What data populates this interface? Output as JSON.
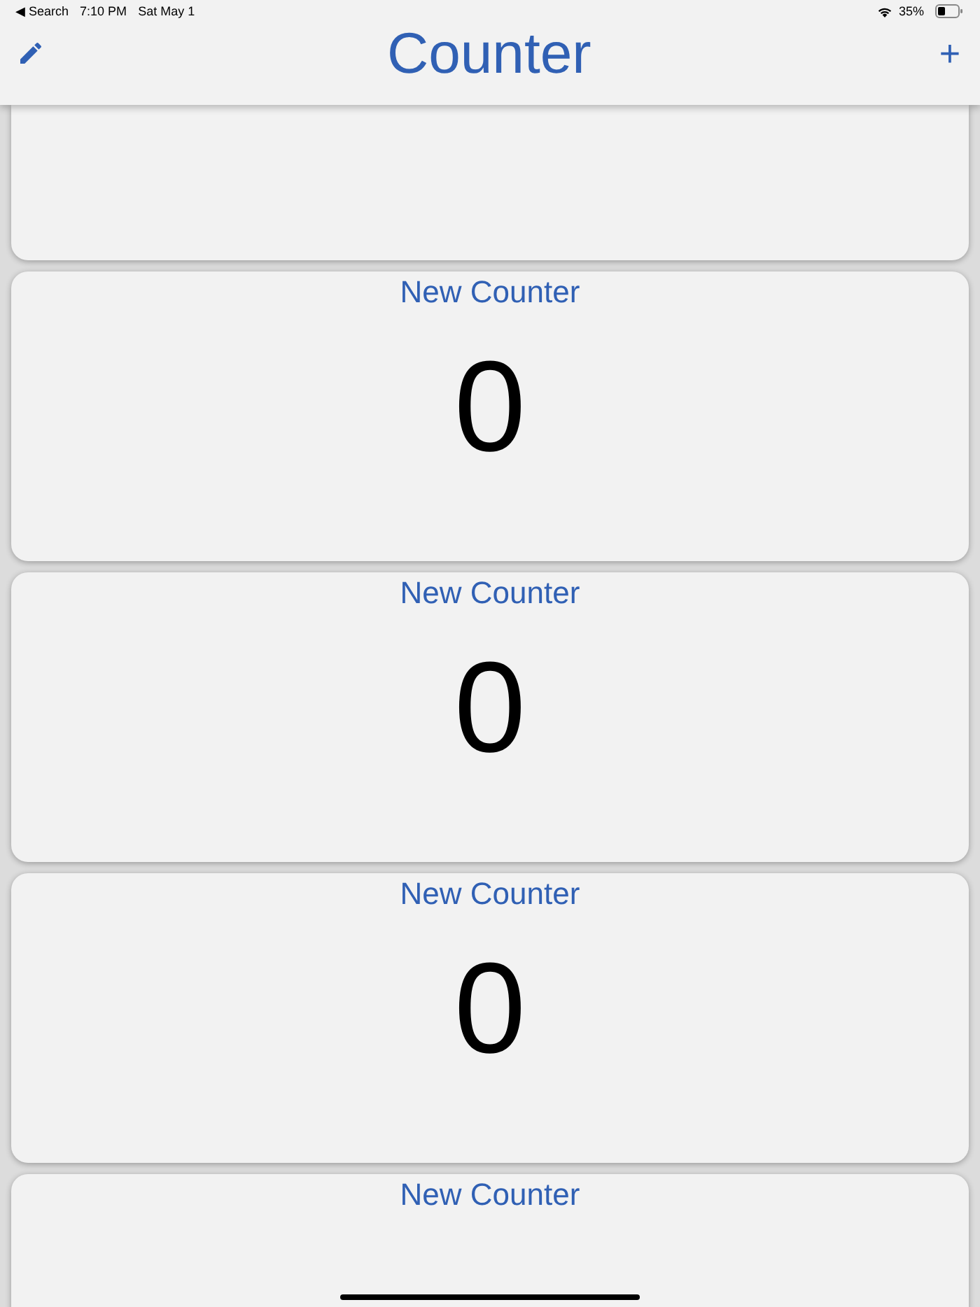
{
  "status_bar": {
    "back": "◀ Search",
    "time": "7:10 PM",
    "date": "Sat May 1",
    "battery": "35%"
  },
  "header": {
    "title": "Counter",
    "add": "+"
  },
  "counters": [
    {
      "kind": "clipped"
    },
    {
      "kind": "full",
      "title": "New Counter",
      "value": "0"
    },
    {
      "kind": "full",
      "title": "New Counter",
      "value": "0"
    },
    {
      "kind": "full",
      "title": "New Counter",
      "value": "0"
    },
    {
      "kind": "full",
      "title": "New Counter"
    }
  ]
}
